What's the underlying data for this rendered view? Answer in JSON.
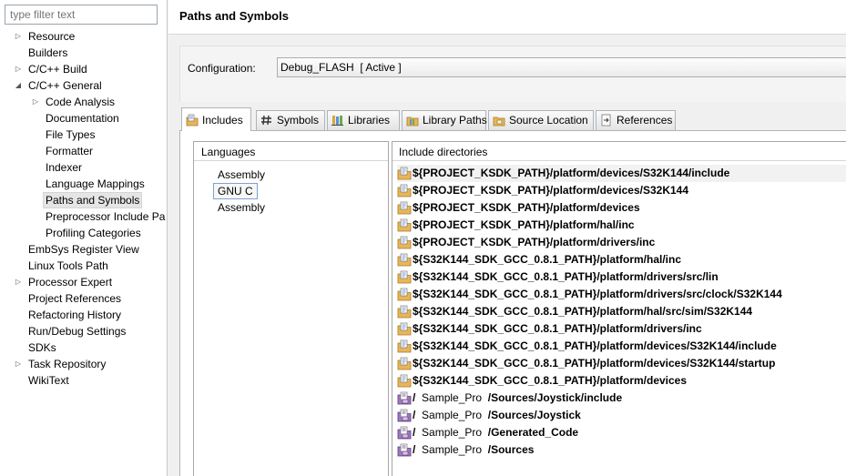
{
  "filter": {
    "placeholder": "type filter text"
  },
  "tree": [
    {
      "label": "Resource",
      "twisty": "▷"
    },
    {
      "label": "Builders",
      "twisty": ""
    },
    {
      "label": "C/C++ Build",
      "twisty": "▷"
    },
    {
      "label": "C/C++ General",
      "twisty": "◢"
    },
    {
      "label": "Code Analysis",
      "twisty": "▷"
    },
    {
      "label": "Documentation",
      "twisty": ""
    },
    {
      "label": "File Types",
      "twisty": ""
    },
    {
      "label": "Formatter",
      "twisty": ""
    },
    {
      "label": "Indexer",
      "twisty": ""
    },
    {
      "label": "Language Mappings",
      "twisty": ""
    },
    {
      "label": "Paths and Symbols",
      "twisty": ""
    },
    {
      "label": "Preprocessor Include Pa",
      "twisty": ""
    },
    {
      "label": "Profiling Categories",
      "twisty": ""
    },
    {
      "label": "EmbSys Register View",
      "twisty": ""
    },
    {
      "label": "Linux Tools Path",
      "twisty": ""
    },
    {
      "label": "Processor Expert",
      "twisty": "▷"
    },
    {
      "label": "Project References",
      "twisty": ""
    },
    {
      "label": "Refactoring History",
      "twisty": ""
    },
    {
      "label": "Run/Debug Settings",
      "twisty": ""
    },
    {
      "label": "SDKs",
      "twisty": ""
    },
    {
      "label": "Task Repository",
      "twisty": "▷"
    },
    {
      "label": "WikiText",
      "twisty": ""
    }
  ],
  "page": {
    "title": "Paths and Symbols"
  },
  "config": {
    "label": "Configuration:",
    "value": "Debug_FLASH  [ Active ]"
  },
  "tabs": [
    {
      "label": "Includes",
      "icon": "includes-icon"
    },
    {
      "label": "Symbols",
      "icon": "hash-icon"
    },
    {
      "label": "Libraries",
      "icon": "libraries-icon"
    },
    {
      "label": "Library Paths",
      "icon": "library-folder-icon"
    },
    {
      "label": "Source Location",
      "icon": "source-folder-icon"
    },
    {
      "label": "References",
      "icon": "references-icon"
    }
  ],
  "languages": {
    "header": "Languages",
    "items": [
      "Assembly",
      "GNU C",
      "Assembly"
    ]
  },
  "includes": {
    "header": "Include directories",
    "items": [
      {
        "path": "${PROJECT_KSDK_PATH}/platform/devices/S32K144/include",
        "kind": "folder"
      },
      {
        "path": "${PROJECT_KSDK_PATH}/platform/devices/S32K144",
        "kind": "folder"
      },
      {
        "path": "${PROJECT_KSDK_PATH}/platform/devices",
        "kind": "folder"
      },
      {
        "path": "${PROJECT_KSDK_PATH}/platform/hal/inc",
        "kind": "folder"
      },
      {
        "path": "${PROJECT_KSDK_PATH}/platform/drivers/inc",
        "kind": "folder"
      },
      {
        "path": "${S32K144_SDK_GCC_0.8.1_PATH}/platform/hal/inc",
        "kind": "folder"
      },
      {
        "path": "${S32K144_SDK_GCC_0.8.1_PATH}/platform/drivers/src/lin",
        "kind": "folder"
      },
      {
        "path": "${S32K144_SDK_GCC_0.8.1_PATH}/platform/drivers/src/clock/S32K144",
        "kind": "folder"
      },
      {
        "path": "${S32K144_SDK_GCC_0.8.1_PATH}/platform/hal/src/sim/S32K144",
        "kind": "folder"
      },
      {
        "path": "${S32K144_SDK_GCC_0.8.1_PATH}/platform/drivers/inc",
        "kind": "folder"
      },
      {
        "path": "${S32K144_SDK_GCC_0.8.1_PATH}/platform/devices/S32K144/include",
        "kind": "folder"
      },
      {
        "path": "${S32K144_SDK_GCC_0.8.1_PATH}/platform/devices/S32K144/startup",
        "kind": "folder"
      },
      {
        "path": "${S32K144_SDK_GCC_0.8.1_PATH}/platform/devices",
        "kind": "folder"
      },
      {
        "prefix": "/  ",
        "project": "Sample_Pro",
        "path": "/Sources/Joystick/include",
        "kind": "workspace"
      },
      {
        "prefix": "/  ",
        "project": "Sample_Pro",
        "path": "/Sources/Joystick",
        "kind": "workspace"
      },
      {
        "prefix": "/  ",
        "project": "Sample_Pro",
        "path": "/Generated_Code",
        "kind": "workspace"
      },
      {
        "prefix": "/  ",
        "project": "Sample_Pro",
        "path": "/Sources",
        "kind": "workspace"
      }
    ]
  },
  "colors": {
    "selection": "#e5e5e5",
    "tab_border": "#aeb4bb",
    "folder": "#e8b659",
    "workspace": "#8a5ca8"
  }
}
